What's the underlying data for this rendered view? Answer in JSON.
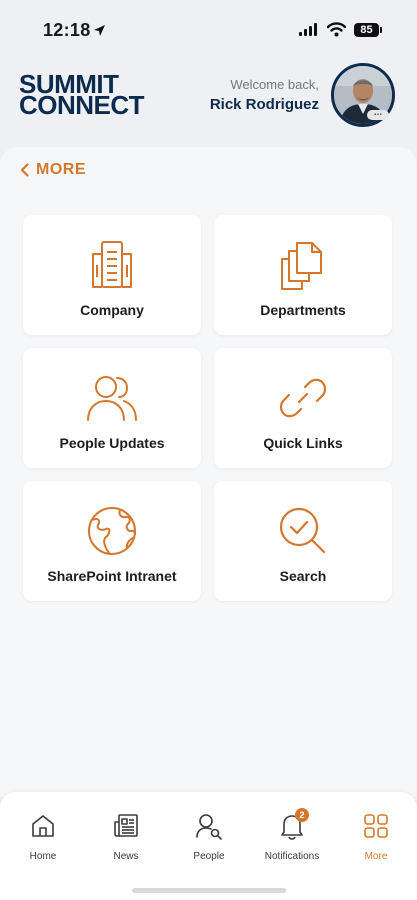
{
  "status_bar": {
    "time": "12:18",
    "battery": "85"
  },
  "header": {
    "logo_line1": "SUMMIT",
    "logo_line2": "CONNECT",
    "welcome_text": "Welcome back,",
    "user_name": "Rick Rodriguez",
    "avatar_more": "..."
  },
  "nav": {
    "back_label": "MORE"
  },
  "tiles": [
    {
      "label": "Company",
      "icon": "building-icon"
    },
    {
      "label": "Departments",
      "icon": "documents-icon"
    },
    {
      "label": "People Updates",
      "icon": "people-icon"
    },
    {
      "label": "Quick Links",
      "icon": "link-icon"
    },
    {
      "label": "SharePoint Intranet",
      "icon": "globe-icon"
    },
    {
      "label": "Search",
      "icon": "search-check-icon"
    }
  ],
  "tab_bar": {
    "tabs": [
      {
        "label": "Home",
        "icon": "home-icon"
      },
      {
        "label": "News",
        "icon": "news-icon"
      },
      {
        "label": "People",
        "icon": "people-search-icon"
      },
      {
        "label": "Notifications",
        "icon": "bell-icon",
        "badge": "2"
      },
      {
        "label": "More",
        "icon": "grid-icon",
        "active": true
      }
    ]
  },
  "colors": {
    "accent": "#d4772c",
    "brand_navy": "#0d2b4e",
    "background": "#f6f7f9"
  }
}
